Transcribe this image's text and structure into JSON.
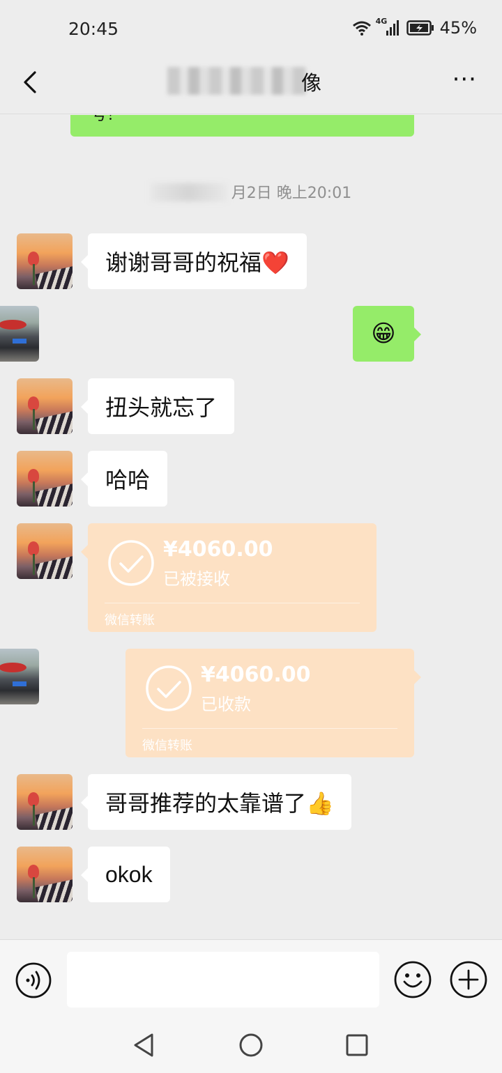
{
  "status": {
    "time": "20:45",
    "network": "4G",
    "battery": "45%"
  },
  "header": {
    "title_visible": "像",
    "back_icon": "chevron-left-icon",
    "more_icon": "ellipsis-icon",
    "more_label": "···"
  },
  "chat": {
    "partial_top_text": "号！",
    "timestamp_visible": "月2日 晚上20:01",
    "messages": [
      {
        "side": "left",
        "text": "谢谢哥哥的祝福❤️"
      },
      {
        "side": "right",
        "text": "😁"
      },
      {
        "side": "left",
        "text": "扭头就忘了"
      },
      {
        "side": "left",
        "text": "哈哈"
      },
      {
        "side": "left",
        "type": "transfer",
        "amount": "¥4060.00",
        "status": "已被接收",
        "footer": "微信转账"
      },
      {
        "side": "right",
        "type": "transfer",
        "amount": "¥4060.00",
        "status": "已收款",
        "footer": "微信转账"
      },
      {
        "side": "left",
        "text": "哥哥推荐的太靠谱了👍"
      },
      {
        "side": "left",
        "text": "okok"
      }
    ]
  },
  "input": {
    "placeholder": "",
    "voice_icon": "voice-icon",
    "emoji_icon": "emoji-icon",
    "plus_icon": "plus-icon"
  },
  "system_nav": {
    "back": "triangle-back-icon",
    "home": "circle-home-icon",
    "recents": "square-recents-icon"
  },
  "colors": {
    "background": "#ededed",
    "my_bubble": "#95ec69",
    "transfer_bubble": "#fde1c4",
    "their_bubble": "#ffffff"
  }
}
